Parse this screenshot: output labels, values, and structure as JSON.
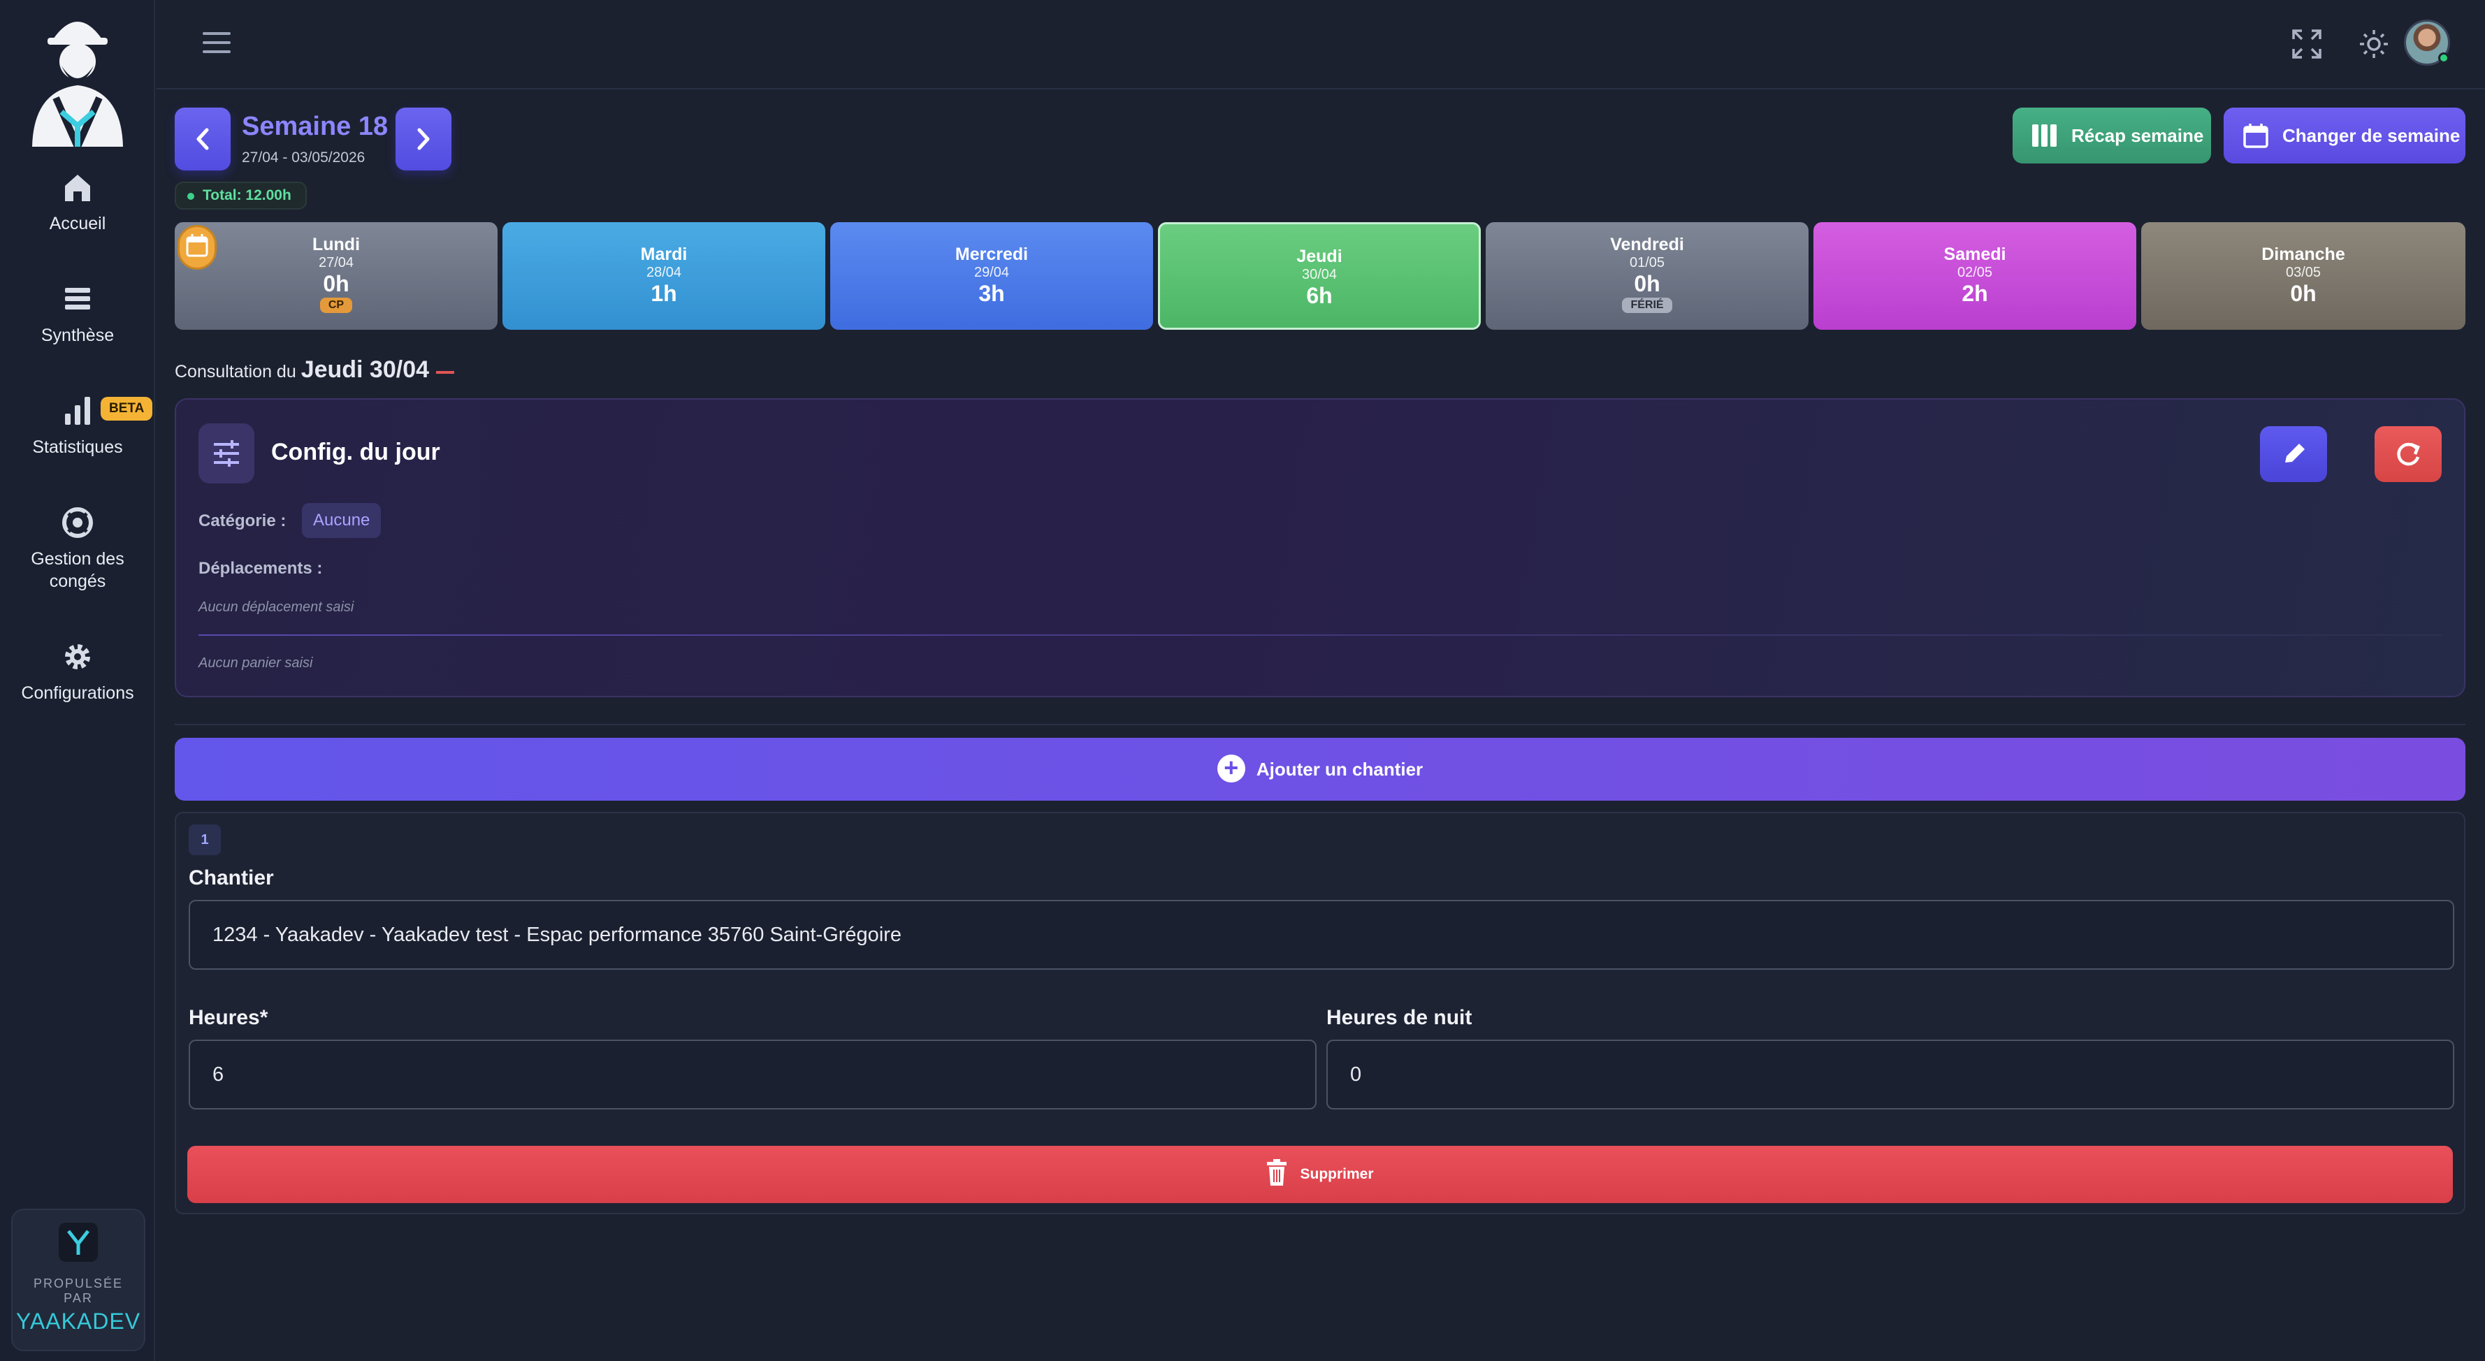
{
  "sidebar": {
    "items": [
      {
        "label": "Accueil",
        "icon": "home-icon"
      },
      {
        "label": "Synthèse",
        "icon": "list-icon"
      },
      {
        "label": "Statistiques",
        "icon": "bar-chart-icon"
      },
      {
        "label": "Gestion des\ncongés",
        "icon": "lifebuoy-icon"
      },
      {
        "label": "Configurations",
        "icon": "gear-icon"
      }
    ],
    "beta_label": "BETA",
    "powered": {
      "line1": "PROPULSÉE",
      "line2": "PAR",
      "brand": "YAAKADEV"
    }
  },
  "topbar": {
    "icons": [
      "menu-icon",
      "fullscreen-icon",
      "sun-icon",
      "avatar"
    ]
  },
  "week": {
    "title": "Semaine 18",
    "range": "27/04 - 03/05/2026",
    "total": "Total: 12.00h",
    "recap_label": "Récap semaine",
    "change_label": "Changer de semaine"
  },
  "days": [
    {
      "name": "Lundi",
      "date": "27/04",
      "hours": "0h",
      "badge": "CP"
    },
    {
      "name": "Mardi",
      "date": "28/04",
      "hours": "1h",
      "badge": ""
    },
    {
      "name": "Mercredi",
      "date": "29/04",
      "hours": "3h",
      "badge": ""
    },
    {
      "name": "Jeudi",
      "date": "30/04",
      "hours": "6h",
      "badge": "",
      "selected": true
    },
    {
      "name": "Vendredi",
      "date": "01/05",
      "hours": "0h",
      "badge": "FÉRIÉ"
    },
    {
      "name": "Samedi",
      "date": "02/05",
      "hours": "2h",
      "badge": ""
    },
    {
      "name": "Dimanche",
      "date": "03/05",
      "hours": "0h",
      "badge": ""
    }
  ],
  "consultation": {
    "prefix": "Consultation du",
    "day": "Jeudi 30/04"
  },
  "config": {
    "title": "Config. du jour",
    "category_label": "Catégorie :",
    "category_value": "Aucune",
    "moves_label": "Déplacements :",
    "no_moves": "Aucun déplacement saisi",
    "no_basket": "Aucun panier saisi"
  },
  "add_label": "Ajouter un chantier",
  "chantier": {
    "number": "1",
    "label": "Chantier",
    "value": "1234 - Yaakadev  - Yaakadev test  - Espac performance 35760 Saint-Grégoire",
    "hours_label": "Heures*",
    "hours_value": "6",
    "night_label": "Heures de nuit",
    "night_value": "0",
    "delete_label": "Supprimer"
  },
  "colors": {
    "accent": "#6a64f0",
    "selected_day": "#5cc272",
    "danger": "#e14a54",
    "recap": "#3fa37a"
  }
}
